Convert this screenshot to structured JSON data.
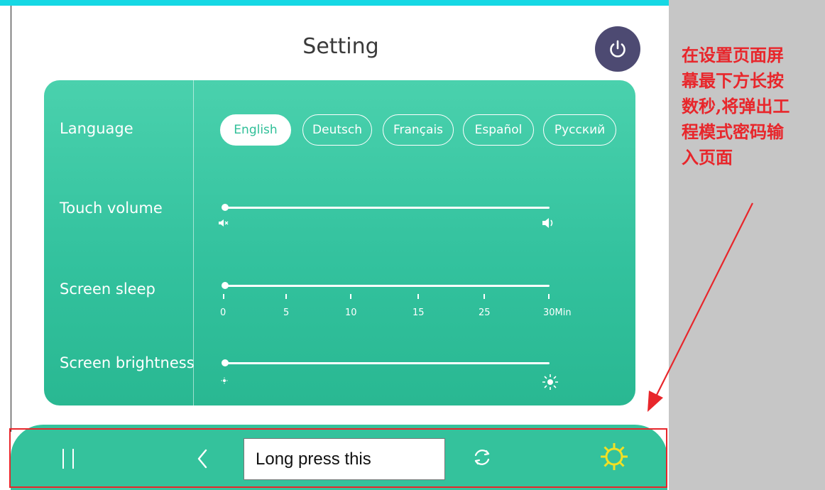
{
  "header": {
    "title": "Setting"
  },
  "settings": {
    "language": {
      "label": "Language",
      "options": [
        "English",
        "Deutsch",
        "Français",
        "Español",
        "Русский"
      ],
      "selected": "English"
    },
    "touch_volume": {
      "label": "Touch volume",
      "level": 0,
      "min_icon": "mute-icon",
      "max_icon": "speaker-icon"
    },
    "screen_sleep": {
      "label": "Screen sleep",
      "ticks": [
        "0",
        "5",
        "10",
        "15",
        "25",
        "30Min"
      ],
      "value": "0"
    },
    "screen_brightness": {
      "label": "Screen brightness",
      "level": 0,
      "min_icon": "dim-sun-icon",
      "max_icon": "bright-sun-icon"
    }
  },
  "navbar": {
    "icons": [
      "pause-icon",
      "back-icon",
      "sync-icon",
      "gear-icon"
    ],
    "callout": "Long press this"
  },
  "annotation": {
    "text": "在设置页面屏\n幕最下方长按\n数秒,将弹出工\n程模式密码输\n入页面"
  },
  "colors": {
    "accent": "#34c29c",
    "power_button": "#4d4a72",
    "annotation_red": "#e8262b",
    "gear_yellow": "#f2e024"
  }
}
